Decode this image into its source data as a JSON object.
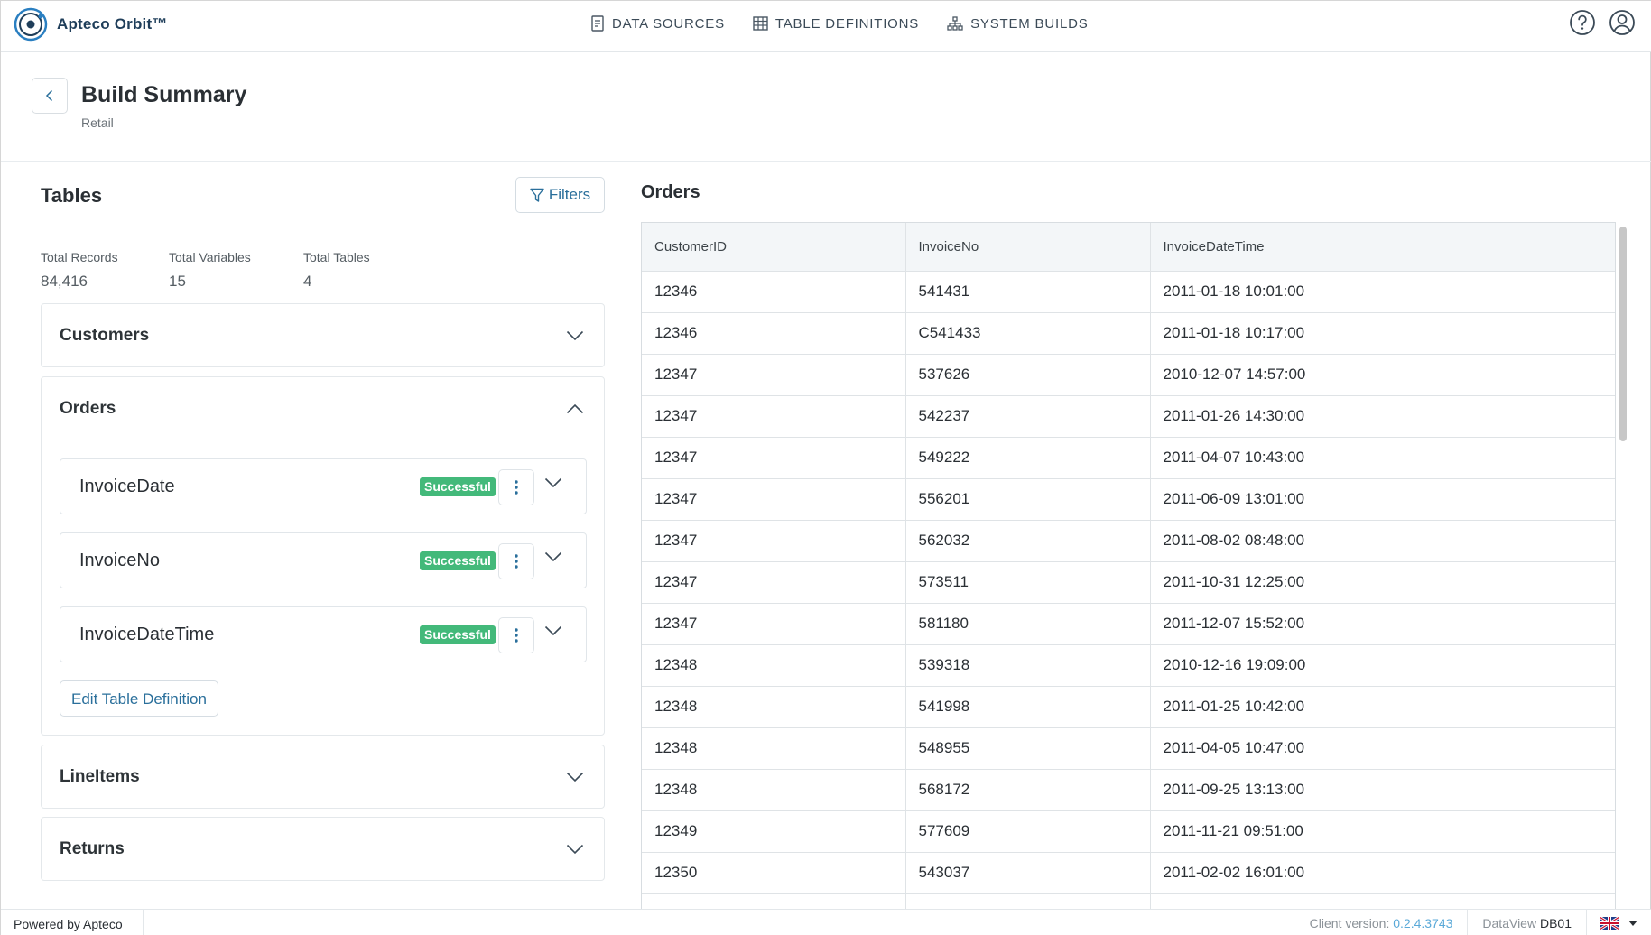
{
  "app": {
    "name": "Apteco Orbit™"
  },
  "nav": {
    "items": [
      {
        "label": "DATA SOURCES",
        "icon": "document-icon"
      },
      {
        "label": "TABLE DEFINITIONS",
        "icon": "table-icon"
      },
      {
        "label": "SYSTEM BUILDS",
        "icon": "hierarchy-icon"
      }
    ],
    "help_icon": "help-icon",
    "user_icon": "user-icon"
  },
  "header": {
    "title": "Build Summary",
    "subtitle": "Retail"
  },
  "tables_panel": {
    "title": "Tables",
    "filters_label": "Filters",
    "stats": [
      {
        "label": "Total Records",
        "value": "84,416"
      },
      {
        "label": "Total Variables",
        "value": "15"
      },
      {
        "label": "Total Tables",
        "value": "4"
      }
    ],
    "tables": [
      {
        "name": "Customers",
        "expanded": false
      },
      {
        "name": "Orders",
        "expanded": true
      },
      {
        "name": "LineItems",
        "expanded": false
      },
      {
        "name": "Returns",
        "expanded": false
      }
    ],
    "orders_variables": [
      {
        "name": "InvoiceDate",
        "status": "Successful"
      },
      {
        "name": "InvoiceNo",
        "status": "Successful"
      },
      {
        "name": "InvoiceDateTime",
        "status": "Successful"
      }
    ],
    "edit_label": "Edit Table Definition"
  },
  "grid": {
    "title": "Orders",
    "columns": [
      "CustomerID",
      "InvoiceNo",
      "InvoiceDateTime"
    ],
    "rows": [
      [
        "12346",
        "541431",
        "2011-01-18 10:01:00"
      ],
      [
        "12346",
        "C541433",
        "2011-01-18 10:17:00"
      ],
      [
        "12347",
        "537626",
        "2010-12-07 14:57:00"
      ],
      [
        "12347",
        "542237",
        "2011-01-26 14:30:00"
      ],
      [
        "12347",
        "549222",
        "2011-04-07 10:43:00"
      ],
      [
        "12347",
        "556201",
        "2011-06-09 13:01:00"
      ],
      [
        "12347",
        "562032",
        "2011-08-02 08:48:00"
      ],
      [
        "12347",
        "573511",
        "2011-10-31 12:25:00"
      ],
      [
        "12347",
        "581180",
        "2011-12-07 15:52:00"
      ],
      [
        "12348",
        "539318",
        "2010-12-16 19:09:00"
      ],
      [
        "12348",
        "541998",
        "2011-01-25 10:42:00"
      ],
      [
        "12348",
        "548955",
        "2011-04-05 10:47:00"
      ],
      [
        "12348",
        "568172",
        "2011-09-25 13:13:00"
      ],
      [
        "12349",
        "577609",
        "2011-11-21 09:51:00"
      ],
      [
        "12350",
        "543037",
        "2011-02-02 16:01:00"
      ],
      [
        "",
        "",
        ""
      ]
    ]
  },
  "footer": {
    "powered_by": "Powered by Apteco",
    "client_version_label": "Client version:",
    "client_version": "0.2.4.3743",
    "dataview_label": "DataView",
    "dataview": "DB01",
    "language_icon": "uk-flag-icon"
  },
  "colors": {
    "accent": "#2a6f9b",
    "success": "#43b97a",
    "link": "#5aa9d8"
  }
}
